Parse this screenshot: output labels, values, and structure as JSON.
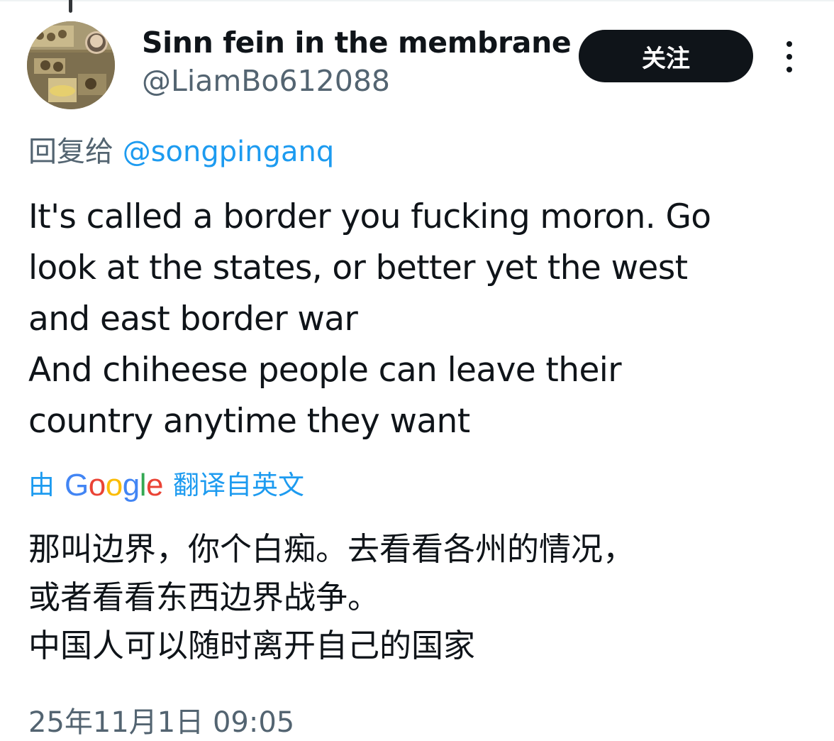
{
  "tweet": {
    "author": {
      "display_name": "Sinn fein in the membrane",
      "handle": "@LiamBo612088"
    },
    "follow_label": "关注",
    "more_icon": "more-vertical-icon",
    "reply_prefix": "回复给",
    "reply_mention": "@songpinganq",
    "body_lines": [
      "It's called a border you fucking moron. Go",
      "look at the states, or better yet the west",
      "and east border war",
      "And chiheese people can leave their",
      "country anytime they want"
    ],
    "translation": {
      "prefix": "由",
      "provider": [
        "G",
        "o",
        "o",
        "g",
        "l",
        "e"
      ],
      "provider_colors": [
        "#4285F4",
        "#EA4335",
        "#FBBC05",
        "#4285F4",
        "#34A853",
        "#EA4335"
      ],
      "suffix": "翻译自英文"
    },
    "translated_lines": [
      "那叫边界，你个白痴。去看看各州的情况，",
      "或者看看东西边界战争。",
      "中国人可以随时离开自己的国家"
    ],
    "timestamp": "25年11月1日 09:05"
  },
  "colors": {
    "text_primary": "#0f1419",
    "text_secondary": "#536471",
    "accent": "#1d9bf0",
    "button_bg": "#0f1419",
    "button_text": "#ffffff"
  }
}
